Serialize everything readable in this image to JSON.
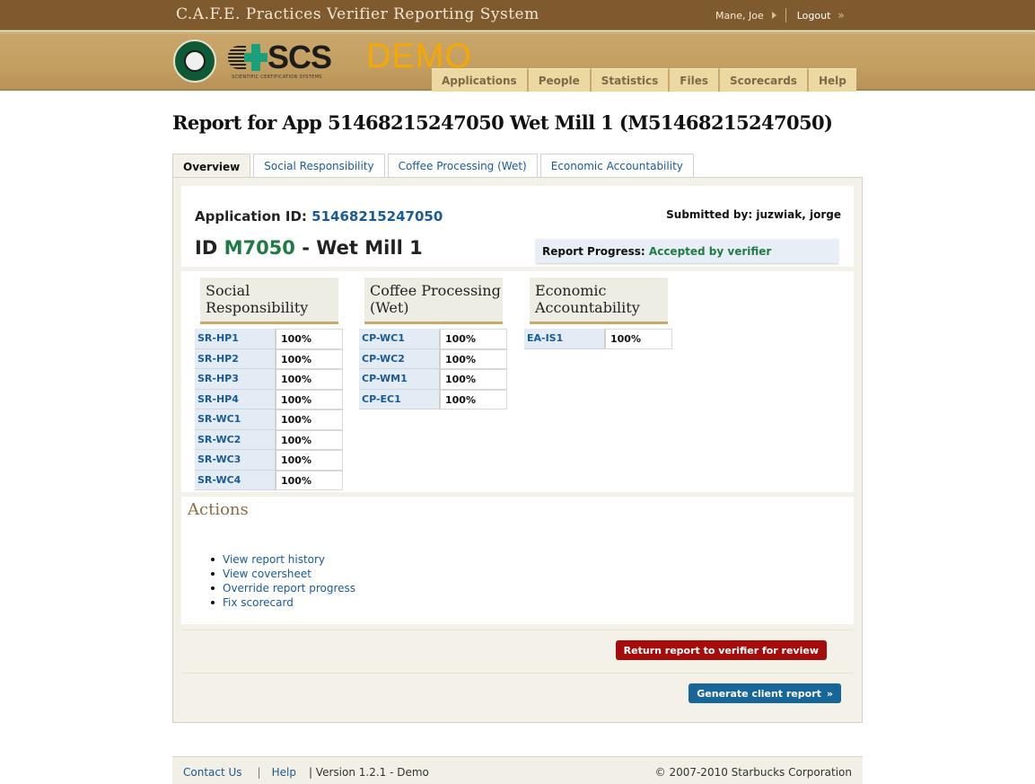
{
  "header": {
    "system_title": "C.A.F.E. Practices Verifier Reporting System",
    "user_name": "Mane, Joe",
    "logout_label": "Logout",
    "demo_label": "DEMO",
    "scs_text": "SCS",
    "scs_subtitle": "SCIENTIFIC CERTIFICATION SYSTEMS"
  },
  "nav": {
    "items": [
      {
        "label": "Applications"
      },
      {
        "label": "People"
      },
      {
        "label": "Statistics"
      },
      {
        "label": "Files"
      },
      {
        "label": "Scorecards"
      },
      {
        "label": "Help"
      }
    ]
  },
  "page_title": "Report for App 51468215247050 Wet Mill 1 (M51468215247050)",
  "tabs": [
    {
      "label": "Overview",
      "active": true
    },
    {
      "label": "Social Responsibility"
    },
    {
      "label": "Coffee Processing (Wet)"
    },
    {
      "label": "Economic Accountability"
    }
  ],
  "summary": {
    "app_id_label": "Application ID:",
    "app_id_value": "51468215247050",
    "id_prefix": "ID",
    "id_value": "M7050",
    "id_suffix": "- Wet Mill 1",
    "submitted_label": "Submitted by:",
    "submitted_value": "juzwiak, jorge",
    "progress_label": "Report Progress:",
    "progress_value": "Accepted by verifier"
  },
  "sections": [
    {
      "title_line1": "Social",
      "title_line2": "Responsibility",
      "rows": [
        {
          "code": "SR-HP1",
          "value": "100%"
        },
        {
          "code": "SR-HP2",
          "value": "100%"
        },
        {
          "code": "SR-HP3",
          "value": "100%"
        },
        {
          "code": "SR-HP4",
          "value": "100%"
        },
        {
          "code": "SR-WC1",
          "value": "100%"
        },
        {
          "code": "SR-WC2",
          "value": "100%"
        },
        {
          "code": "SR-WC3",
          "value": "100%"
        },
        {
          "code": "SR-WC4",
          "value": "100%"
        }
      ]
    },
    {
      "title_line1": "Coffee Processing",
      "title_line2": "(Wet)",
      "rows": [
        {
          "code": "CP-WC1",
          "value": "100%"
        },
        {
          "code": "CP-WC2",
          "value": "100%"
        },
        {
          "code": "CP-WM1",
          "value": "100%"
        },
        {
          "code": "CP-EC1",
          "value": "100%"
        }
      ]
    },
    {
      "title_line1": "Economic",
      "title_line2": "Accountability",
      "rows": [
        {
          "code": "EA-IS1",
          "value": "100%"
        }
      ]
    }
  ],
  "actions": {
    "title": "Actions",
    "items": [
      {
        "label": "View report history"
      },
      {
        "label": "View coversheet"
      },
      {
        "label": "Override report progress"
      },
      {
        "label": "Fix scorecard"
      }
    ]
  },
  "buttons": {
    "return_label": "Return report to verifier for review",
    "generate_label": "Generate client report",
    "generate_icon": "»"
  },
  "footer": {
    "contact_label": "Contact Us",
    "help_label": "Help",
    "version": "| Version 1.2.1 - Demo",
    "copyright": "© 2007-2010 Starbucks Corporation"
  },
  "colors": {
    "header_brown": "#7f5a2e",
    "banner_tan": "#c39f62",
    "nav_tab": "#ecd9a2",
    "link_blue": "#1a5a96",
    "status_green": "#1f7a45",
    "demo_orange": "#f7a800",
    "button_red": "#a50d0d",
    "button_blue": "#17669a"
  }
}
